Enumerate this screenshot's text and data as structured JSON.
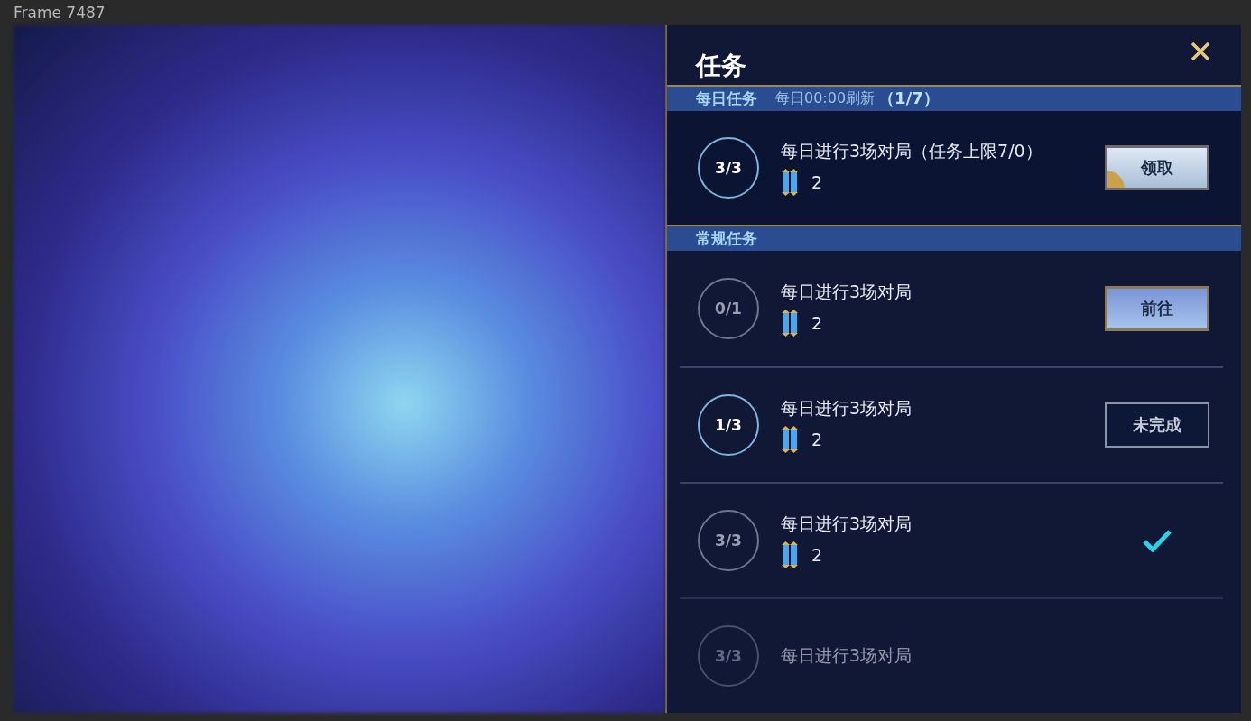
{
  "frame_label": "Frame 7487",
  "panel": {
    "title": "任务",
    "daily": {
      "heading": "每日任务",
      "refresh_note": "每日00:00刷新",
      "count": "（1/7）",
      "tasks": [
        {
          "progress": "3/3",
          "highlighted": true,
          "faded": false,
          "description": "每日进行3场对局（任务上限7/0）",
          "reward": "2",
          "action": {
            "kind": "claim",
            "label": "领取"
          }
        }
      ]
    },
    "regular": {
      "heading": "常规任务",
      "tasks": [
        {
          "progress": "0/1",
          "highlighted": false,
          "faded": false,
          "description": "每日进行3场对局",
          "reward": "2",
          "action": {
            "kind": "go",
            "label": "前往"
          }
        },
        {
          "progress": "1/3",
          "highlighted": true,
          "faded": false,
          "description": "每日进行3场对局",
          "reward": "2",
          "action": {
            "kind": "incomplete",
            "label": "未完成"
          }
        },
        {
          "progress": "3/3",
          "highlighted": false,
          "faded": false,
          "description": "每日进行3场对局",
          "reward": "2",
          "action": {
            "kind": "done"
          }
        },
        {
          "progress": "3/3",
          "highlighted": false,
          "faded": true,
          "description": "每日进行3场对局"
        }
      ]
    }
  }
}
